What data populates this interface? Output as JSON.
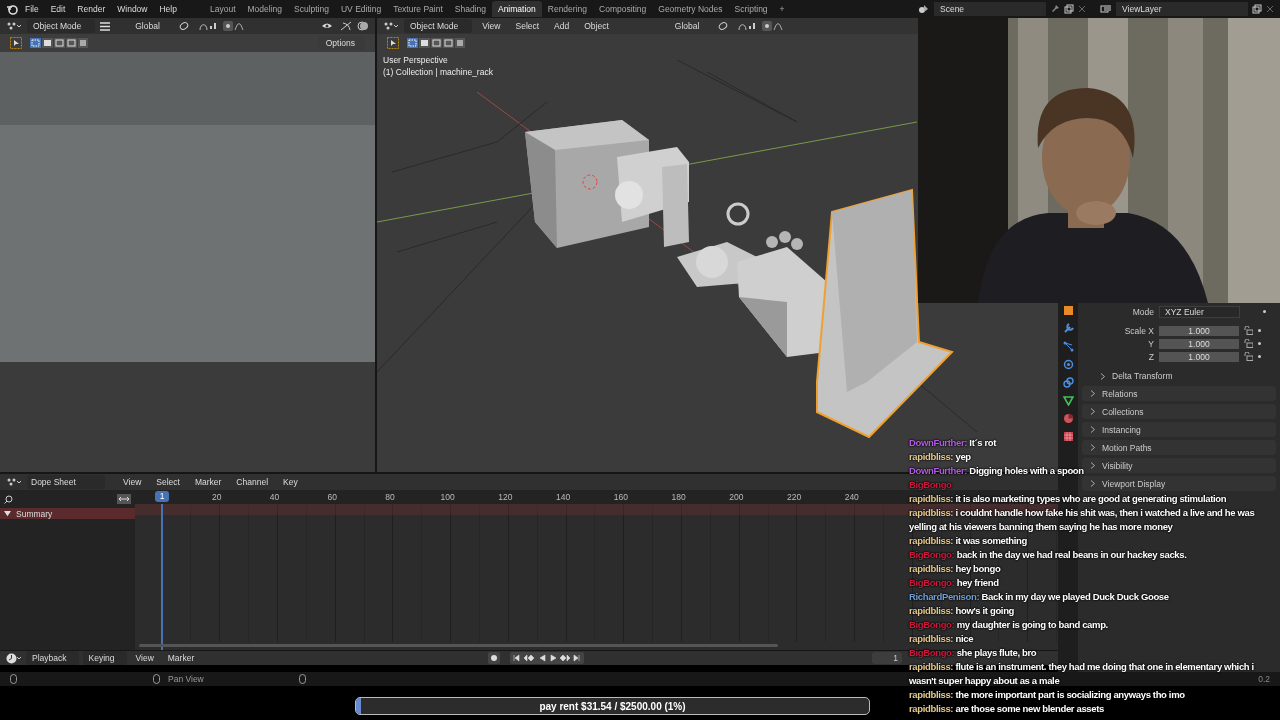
{
  "topbar": {
    "menus": [
      "File",
      "Edit",
      "Render",
      "Window",
      "Help"
    ],
    "workspaces": [
      {
        "label": "Layout",
        "selected": false
      },
      {
        "label": "Modeling",
        "selected": false
      },
      {
        "label": "Sculpting",
        "selected": false
      },
      {
        "label": "UV Editing",
        "selected": false
      },
      {
        "label": "Texture Paint",
        "selected": false
      },
      {
        "label": "Shading",
        "selected": false
      },
      {
        "label": "Animation",
        "selected": true
      },
      {
        "label": "Rendering",
        "selected": false
      },
      {
        "label": "Compositing",
        "selected": false
      },
      {
        "label": "Geometry Nodes",
        "selected": false
      },
      {
        "label": "Scripting",
        "selected": false
      }
    ],
    "add_workspace": "+",
    "scene": "Scene",
    "view_layer": "ViewLayer"
  },
  "left_editor": {
    "mode": "Object Mode",
    "orientation": "Global",
    "options": "Options"
  },
  "viewport": {
    "mode": "Object Mode",
    "menus": [
      "View",
      "Select",
      "Add",
      "Object"
    ],
    "orientation": "Global",
    "perspective": "User Perspective",
    "collection": "(1) Collection | machine_rack"
  },
  "properties": {
    "mode_label": "Mode",
    "mode": "XYZ Euler",
    "scale": [
      {
        "label": "Scale X",
        "value": "1.000"
      },
      {
        "label": "Y",
        "value": "1.000"
      },
      {
        "label": "Z",
        "value": "1.000"
      }
    ],
    "subpanels": [
      {
        "label": "Delta Transform",
        "expanded": false
      }
    ],
    "panels": [
      {
        "label": "Relations",
        "expanded": false
      },
      {
        "label": "Collections",
        "expanded": false
      },
      {
        "label": "Instancing",
        "expanded": false
      },
      {
        "label": "Motion Paths",
        "expanded": false
      },
      {
        "label": "Visibility",
        "expanded": false
      },
      {
        "label": "Viewport Display",
        "expanded": false
      }
    ]
  },
  "dope_sheet": {
    "editor": "Dope Sheet",
    "menus": [
      "View",
      "Select",
      "Marker",
      "Channel",
      "Key"
    ],
    "current_frame": "1",
    "frame_ticks": [
      "20",
      "40",
      "60",
      "80",
      "100",
      "120",
      "140",
      "160",
      "180",
      "200",
      "220",
      "240"
    ],
    "channels": [
      {
        "label": "Summary",
        "expanded": true
      }
    ]
  },
  "timeline": {
    "menus": [
      {
        "label": "Playback",
        "kind": "dropdown"
      },
      {
        "label": "Keying",
        "kind": "dropdown"
      },
      {
        "label": "View",
        "kind": "menu"
      },
      {
        "label": "Marker",
        "kind": "menu"
      }
    ],
    "current_frame": "1"
  },
  "status_bar": {
    "hint": "Pan View",
    "version": "0.2"
  },
  "chat": {
    "messages": [
      {
        "user": "DownFurther:",
        "color": "#b45be8",
        "text": "It´s rot"
      },
      {
        "user": "rapidbliss:",
        "color": "#e6c88c",
        "text": "yep"
      },
      {
        "user": "DownFurther:",
        "color": "#b45be8",
        "text": "Digging holes with a spoon"
      },
      {
        "user": "BigBongo",
        "color": "#d0163c"
      },
      {
        "user": "rapidbliss:",
        "color": "#e6c88c",
        "text": "it is also marketing types who are good at generating stimulation"
      },
      {
        "user": "rapidbliss:",
        "color": "#e6c88c",
        "text": "i couldnt handle how fake his shit was, then i watched a live and he was yelling at his viewers banning them saying he has more money"
      },
      {
        "user": "rapidbliss:",
        "color": "#e6c88c",
        "text": "it was something"
      },
      {
        "user": "BigBongo:",
        "color": "#d0163c",
        "text": "back in the day we had real beans in our hackey sacks."
      },
      {
        "user": "rapidbliss:",
        "color": "#e6c88c",
        "text": "hey bongo"
      },
      {
        "user": "BigBongo:",
        "color": "#d0163c",
        "text": "hey friend"
      },
      {
        "user": "RichardPenison:",
        "color": "#6e9fd8",
        "text": "Back in my day we played Duck Duck Goose"
      },
      {
        "user": "rapidbliss:",
        "color": "#e6c88c",
        "text": "how's it going"
      },
      {
        "user": "BigBongo:",
        "color": "#d0163c",
        "text": "my daughter is going to band camp."
      },
      {
        "user": "rapidbliss:",
        "color": "#e6c88c",
        "text": "nice"
      },
      {
        "user": "BigBongo:",
        "color": "#d0163c",
        "text": "she plays flute, bro"
      },
      {
        "user": "rapidbliss:",
        "color": "#e6c88c",
        "text": "flute is an instrument. they had me doing that one in elementary which i wasn't super happy about as a male"
      },
      {
        "user": "rapidbliss:",
        "color": "#e6c88c",
        "text": "the more important part is socializing anyways tho imo"
      },
      {
        "user": "rapidbliss:",
        "color": "#e6c88c",
        "text": "are those some new blender assets"
      }
    ]
  },
  "goal": {
    "text": "pay rent $31.54 / $2500.00 (1%)",
    "level": 0.01
  }
}
